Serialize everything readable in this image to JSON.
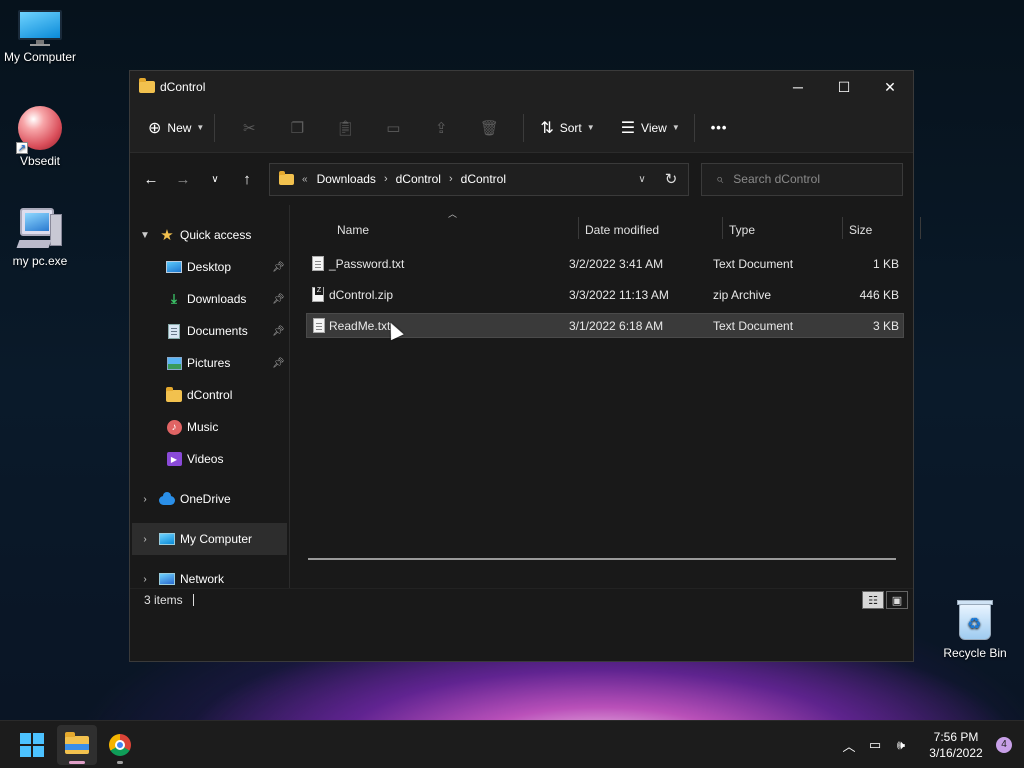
{
  "desktop": {
    "icons": [
      {
        "label": "My Computer"
      },
      {
        "label": "Vbsedit"
      },
      {
        "label": "my pc.exe"
      },
      {
        "label": "Recycle Bin"
      }
    ]
  },
  "window": {
    "title": "dControl",
    "controls": {
      "minimize": "─",
      "maximize": "☐",
      "close": "✕"
    }
  },
  "commandbar": {
    "new_label": "New",
    "sort_label": "Sort",
    "view_label": "View",
    "more_label": "•••"
  },
  "address": {
    "overflow": "«",
    "crumbs": [
      "Downloads",
      "dControl",
      "dControl"
    ],
    "search_placeholder": "Search dControl"
  },
  "nav": {
    "quick_access": "Quick access",
    "items": [
      "Desktop",
      "Downloads",
      "Documents",
      "Pictures",
      "dControl",
      "Music",
      "Videos"
    ],
    "onedrive": "OneDrive",
    "my_computer": "My Computer",
    "network": "Network"
  },
  "columns": {
    "name": "Name",
    "date": "Date modified",
    "type": "Type",
    "size": "Size"
  },
  "files": [
    {
      "name": "_Password.txt",
      "date": "3/2/2022 3:41 AM",
      "type": "Text Document",
      "size": "1 KB"
    },
    {
      "name": "dControl.zip",
      "date": "3/3/2022 11:13 AM",
      "type": "zip Archive",
      "size": "446 KB"
    },
    {
      "name": "ReadMe.txt",
      "date": "3/1/2022 6:18 AM",
      "type": "Text Document",
      "size": "3 KB"
    }
  ],
  "status": {
    "items": "3 items"
  },
  "taskbar": {
    "time": "7:56 PM",
    "date": "3/16/2022",
    "notifications": "4"
  }
}
